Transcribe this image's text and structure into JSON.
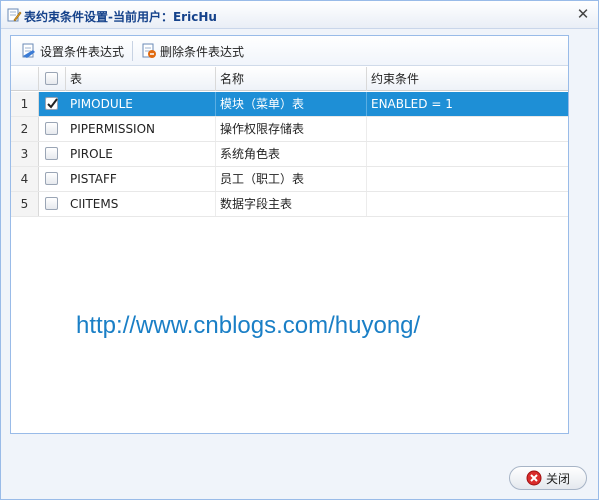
{
  "window": {
    "title": "表约束条件设置-当前用户：EricHu"
  },
  "toolbar": {
    "set_label": "设置条件表达式",
    "delete_label": "删除条件表达式"
  },
  "grid": {
    "columns": [
      "表",
      "名称",
      "约束条件"
    ],
    "rows": [
      {
        "num": "1",
        "table": "PIMODULE",
        "name": "模块（菜单）表",
        "condition": "ENABLED = 1",
        "checked": true,
        "selected": true
      },
      {
        "num": "2",
        "table": "PIPERMISSION",
        "name": "操作权限存储表",
        "condition": "",
        "checked": false,
        "selected": false
      },
      {
        "num": "3",
        "table": "PIROLE",
        "name": "系统角色表",
        "condition": "",
        "checked": false,
        "selected": false
      },
      {
        "num": "4",
        "table": "PISTAFF",
        "name": "员工（职工）表",
        "condition": "",
        "checked": false,
        "selected": false
      },
      {
        "num": "5",
        "table": "CIITEMS",
        "name": "数据字段主表",
        "condition": "",
        "checked": false,
        "selected": false
      }
    ]
  },
  "watermark": "http://www.cnblogs.com/huyong/",
  "footer": {
    "close_label": "关闭"
  },
  "colors": {
    "selected_row": "#1e8fd6",
    "watermark": "#1a7fc6",
    "title": "#15428b"
  },
  "icons": {
    "title": "edit-icon",
    "set": "add-condition-icon",
    "delete": "delete-condition-icon",
    "close": "close-icon",
    "footer_close": "red-x-icon"
  }
}
